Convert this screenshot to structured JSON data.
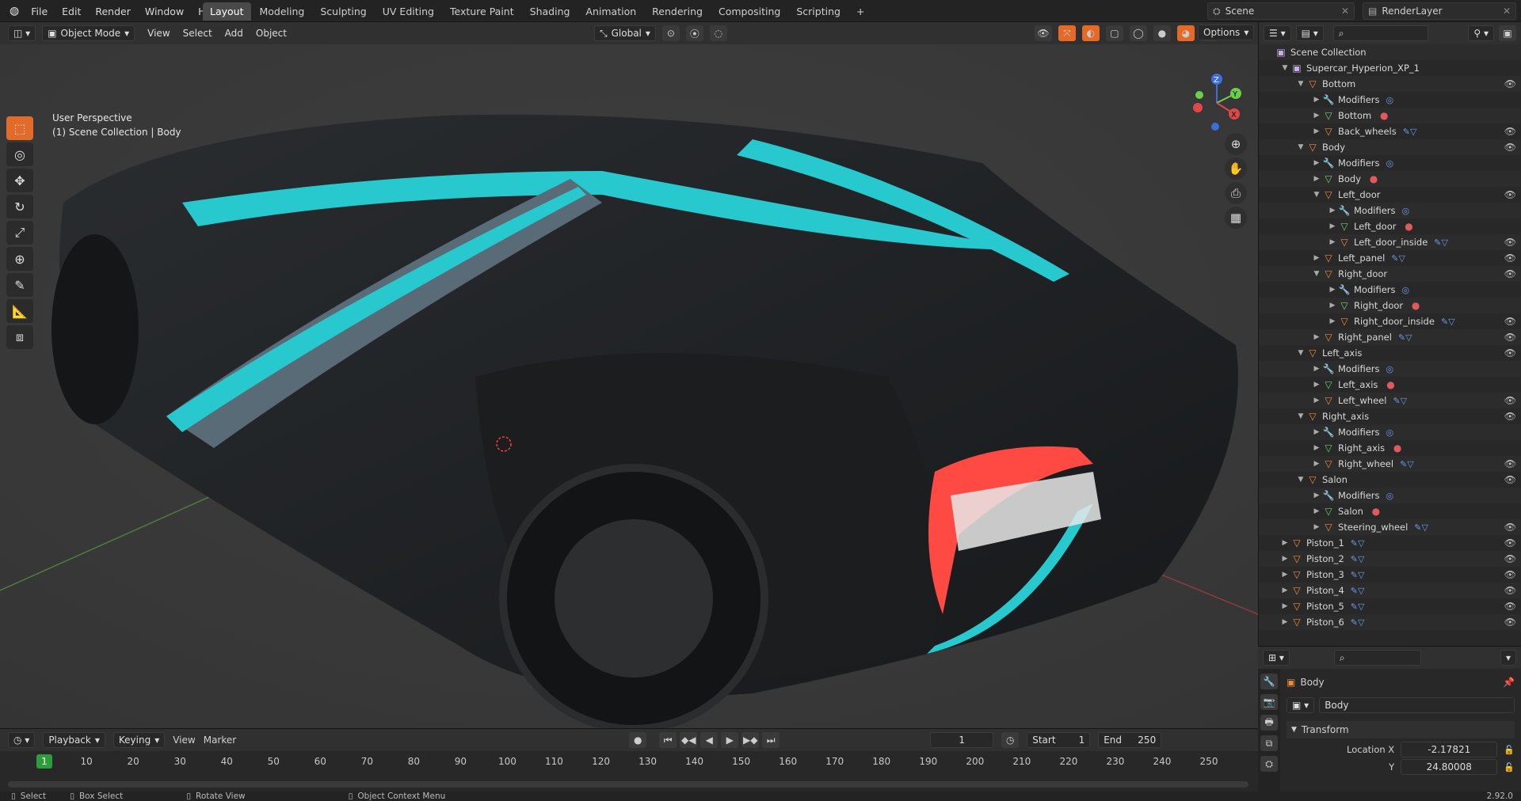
{
  "topbar": {
    "menus": [
      "File",
      "Edit",
      "Render",
      "Window",
      "Help"
    ],
    "workspaces": [
      "Layout",
      "Modeling",
      "Sculpting",
      "UV Editing",
      "Texture Paint",
      "Shading",
      "Animation",
      "Rendering",
      "Compositing",
      "Scripting"
    ],
    "scene": "Scene",
    "render_layer": "RenderLayer",
    "options": "Options"
  },
  "viewport": {
    "mode": "Object Mode",
    "menus": [
      "View",
      "Select",
      "Add",
      "Object"
    ],
    "transform": "Global",
    "title": "User Perspective",
    "subtitle": "(1) Scene Collection | Body"
  },
  "outliner": {
    "root": "Scene Collection",
    "rows": [
      {
        "indent": 1,
        "label": "Supercar_Hyperion_XP_1",
        "type": "coll",
        "exp": true,
        "eye": false
      },
      {
        "indent": 2,
        "label": "Bottom",
        "type": "obj",
        "exp": true,
        "eye": true
      },
      {
        "indent": 3,
        "label": "Modifiers",
        "type": "mod",
        "exp": false,
        "eye": false,
        "extra": "◎"
      },
      {
        "indent": 3,
        "label": "Bottom",
        "type": "mesh",
        "exp": false,
        "eye": false,
        "extra": "●"
      },
      {
        "indent": 3,
        "label": "Back_wheels",
        "type": "obj",
        "exp": false,
        "eye": true,
        "extra": "✎▽"
      },
      {
        "indent": 2,
        "label": "Body",
        "type": "obj",
        "exp": true,
        "eye": true
      },
      {
        "indent": 3,
        "label": "Modifiers",
        "type": "mod",
        "exp": false,
        "eye": false,
        "extra": "◎"
      },
      {
        "indent": 3,
        "label": "Body",
        "type": "mesh",
        "exp": false,
        "eye": false,
        "extra": "●"
      },
      {
        "indent": 3,
        "label": "Left_door",
        "type": "obj",
        "exp": true,
        "eye": true
      },
      {
        "indent": 4,
        "label": "Modifiers",
        "type": "mod",
        "exp": false,
        "eye": false,
        "extra": "◎"
      },
      {
        "indent": 4,
        "label": "Left_door",
        "type": "mesh",
        "exp": false,
        "eye": false,
        "extra": "●"
      },
      {
        "indent": 4,
        "label": "Left_door_inside",
        "type": "obj",
        "exp": false,
        "eye": true,
        "extra": "✎▽"
      },
      {
        "indent": 3,
        "label": "Left_panel",
        "type": "obj",
        "exp": false,
        "eye": true,
        "extra": "✎▽"
      },
      {
        "indent": 3,
        "label": "Right_door",
        "type": "obj",
        "exp": true,
        "eye": true
      },
      {
        "indent": 4,
        "label": "Modifiers",
        "type": "mod",
        "exp": false,
        "eye": false,
        "extra": "◎"
      },
      {
        "indent": 4,
        "label": "Right_door",
        "type": "mesh",
        "exp": false,
        "eye": false,
        "extra": "●"
      },
      {
        "indent": 4,
        "label": "Right_door_inside",
        "type": "obj",
        "exp": false,
        "eye": true,
        "extra": "✎▽"
      },
      {
        "indent": 3,
        "label": "Right_panel",
        "type": "obj",
        "exp": false,
        "eye": true,
        "extra": "✎▽"
      },
      {
        "indent": 2,
        "label": "Left_axis",
        "type": "obj",
        "exp": true,
        "eye": true
      },
      {
        "indent": 3,
        "label": "Modifiers",
        "type": "mod",
        "exp": false,
        "eye": false,
        "extra": "◎"
      },
      {
        "indent": 3,
        "label": "Left_axis",
        "type": "mesh",
        "exp": false,
        "eye": false,
        "extra": "●"
      },
      {
        "indent": 3,
        "label": "Left_wheel",
        "type": "obj",
        "exp": false,
        "eye": true,
        "extra": "✎▽"
      },
      {
        "indent": 2,
        "label": "Right_axis",
        "type": "obj",
        "exp": true,
        "eye": true
      },
      {
        "indent": 3,
        "label": "Modifiers",
        "type": "mod",
        "exp": false,
        "eye": false,
        "extra": "◎"
      },
      {
        "indent": 3,
        "label": "Right_axis",
        "type": "mesh",
        "exp": false,
        "eye": false,
        "extra": "●"
      },
      {
        "indent": 3,
        "label": "Right_wheel",
        "type": "obj",
        "exp": false,
        "eye": true,
        "extra": "✎▽"
      },
      {
        "indent": 2,
        "label": "Salon",
        "type": "obj",
        "exp": true,
        "eye": true
      },
      {
        "indent": 3,
        "label": "Modifiers",
        "type": "mod",
        "exp": false,
        "eye": false,
        "extra": "◎"
      },
      {
        "indent": 3,
        "label": "Salon",
        "type": "mesh",
        "exp": false,
        "eye": false,
        "extra": "●"
      },
      {
        "indent": 3,
        "label": "Steering_wheel",
        "type": "obj",
        "exp": false,
        "eye": true,
        "extra": "✎▽"
      },
      {
        "indent": 1,
        "label": "Piston_1",
        "type": "obj",
        "exp": false,
        "eye": true,
        "extra": "✎▽"
      },
      {
        "indent": 1,
        "label": "Piston_2",
        "type": "obj",
        "exp": false,
        "eye": true,
        "extra": "✎▽"
      },
      {
        "indent": 1,
        "label": "Piston_3",
        "type": "obj",
        "exp": false,
        "eye": true,
        "extra": "✎▽"
      },
      {
        "indent": 1,
        "label": "Piston_4",
        "type": "obj",
        "exp": false,
        "eye": true,
        "extra": "✎▽"
      },
      {
        "indent": 1,
        "label": "Piston_5",
        "type": "obj",
        "exp": false,
        "eye": true,
        "extra": "✎▽"
      },
      {
        "indent": 1,
        "label": "Piston_6",
        "type": "obj",
        "exp": false,
        "eye": true,
        "extra": "✎▽"
      }
    ]
  },
  "properties": {
    "object_name": "Body",
    "data_name": "Body",
    "panel": "Transform",
    "loc_x_label": "Location X",
    "loc_x": "-2.17821",
    "loc_y_label": "Y",
    "loc_y": "24.80008"
  },
  "timeline": {
    "menus": [
      "Playback",
      "Keying",
      "View",
      "Marker"
    ],
    "current_frame": "1",
    "start_label": "Start",
    "start": "1",
    "end_label": "End",
    "end": "250",
    "ticks": [
      "1",
      "10",
      "20",
      "30",
      "40",
      "50",
      "60",
      "70",
      "80",
      "90",
      "100",
      "110",
      "120",
      "130",
      "140",
      "150",
      "160",
      "170",
      "180",
      "190",
      "200",
      "210",
      "220",
      "230",
      "240",
      "250"
    ]
  },
  "status": {
    "select": "Select",
    "box_select": "Box Select",
    "rotate_view": "Rotate View",
    "context_menu": "Object Context Menu",
    "version": "2.92.0"
  }
}
